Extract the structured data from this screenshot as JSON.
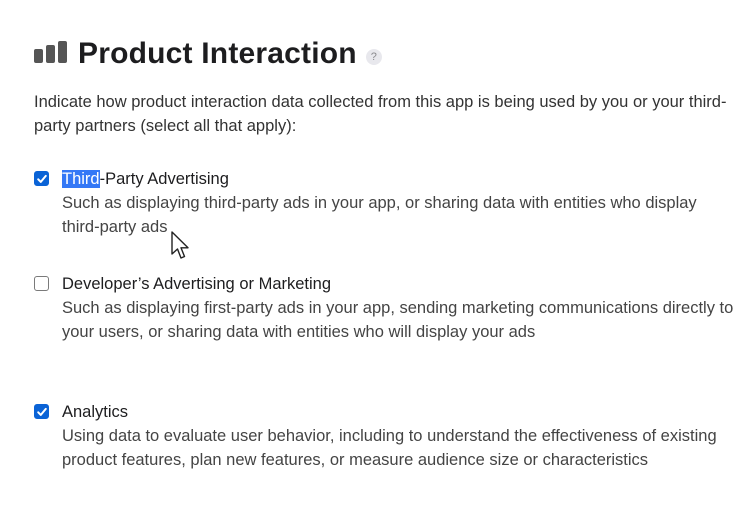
{
  "header": {
    "title": "Product Interaction",
    "icon": "bar-chart-icon",
    "help_icon": "help-icon",
    "help_glyph": "?"
  },
  "intro": "Indicate how product interaction data collected from this app is being used by you or your third-party partners (select all that apply):",
  "options": [
    {
      "label_highlighted": "Third",
      "label_rest": "-Party Advertising",
      "checked": true,
      "description": "Such as displaying third-party ads in your app, or sharing data with entities who display third-party ads"
    },
    {
      "label": "Developer’s Advertising or Marketing",
      "checked": false,
      "description": "Such as displaying first-party ads in your app, sending marketing communications directly to your users, or sharing data with entities who will display your ads"
    },
    {
      "label": "Analytics",
      "checked": true,
      "description": "Using data to evaluate user behavior, including to understand the effectiveness of existing product features, plan new features, or measure audience size or characteristics"
    }
  ],
  "colors": {
    "accent": "#0a63d6",
    "selection": "#3478f6"
  }
}
